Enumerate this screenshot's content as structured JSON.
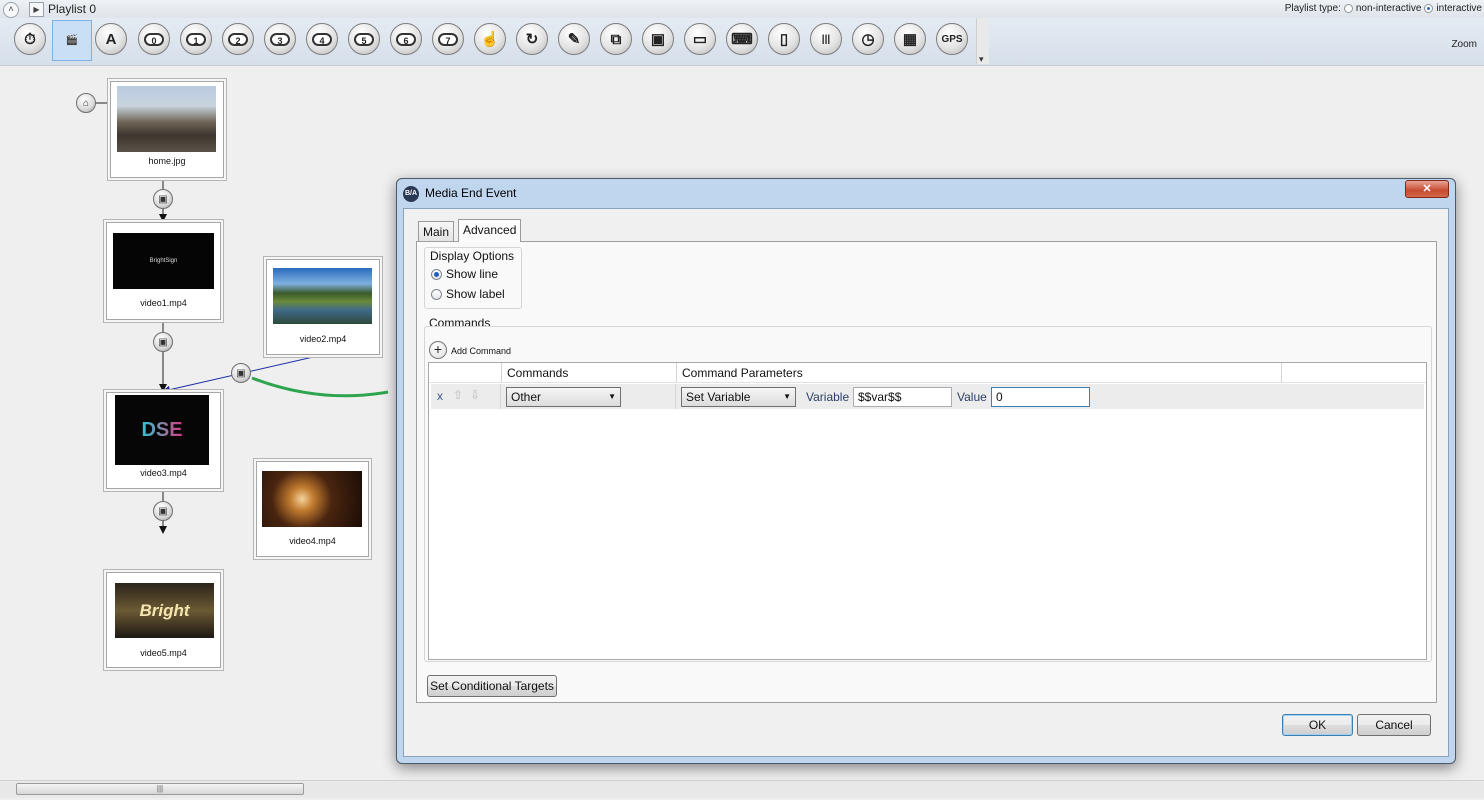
{
  "header": {
    "playlist_title": "Playlist 0",
    "playlist_type_label": "Playlist type:",
    "type_options": [
      {
        "label": "non-interactive",
        "selected": false
      },
      {
        "label": "interactive",
        "selected": true
      }
    ]
  },
  "toolbar": {
    "tools": [
      {
        "icon": "timer-icon",
        "glyph": "⏱"
      },
      {
        "icon": "clapperboard-icon",
        "glyph": "🎬",
        "selected": true
      },
      {
        "icon": "text-image-icon",
        "glyph": "A"
      },
      {
        "icon": "button-0-icon",
        "glyph": "0"
      },
      {
        "icon": "button-1-icon",
        "glyph": "1"
      },
      {
        "icon": "button-2-icon",
        "glyph": "2"
      },
      {
        "icon": "button-3-icon",
        "glyph": "3"
      },
      {
        "icon": "button-4-icon",
        "glyph": "4"
      },
      {
        "icon": "button-5-icon",
        "glyph": "5"
      },
      {
        "icon": "button-6-icon",
        "glyph": "6"
      },
      {
        "icon": "button-7-icon",
        "glyph": "7"
      },
      {
        "icon": "touch-icon",
        "glyph": "☝"
      },
      {
        "icon": "refresh-icon",
        "glyph": "↻"
      },
      {
        "icon": "serial-cable-icon",
        "glyph": "✎"
      },
      {
        "icon": "zone-icon",
        "glyph": "⧉"
      },
      {
        "icon": "media-end-icon",
        "glyph": "▣"
      },
      {
        "icon": "ir-remote-icon",
        "glyph": "▭"
      },
      {
        "icon": "keyboard-icon",
        "glyph": "⌨"
      },
      {
        "icon": "remote-control-icon",
        "glyph": "▯"
      },
      {
        "icon": "barcode-icon",
        "glyph": "|||"
      },
      {
        "icon": "timeclock-icon",
        "glyph": "◷"
      },
      {
        "icon": "calendar-icon",
        "glyph": "▦"
      },
      {
        "icon": "gps-icon",
        "glyph": "GPS"
      }
    ],
    "zoom_label": "Zoom"
  },
  "canvas": {
    "nodes": [
      {
        "caption": "home.jpg"
      },
      {
        "caption": "video1.mp4",
        "thumb_text": "BrightSign"
      },
      {
        "caption": "video2.mp4"
      },
      {
        "caption": "video3.mp4",
        "thumb_text": "DSE"
      },
      {
        "caption": "video4.mp4"
      },
      {
        "caption": "video5.mp4",
        "thumb_text": "Bright"
      }
    ]
  },
  "dialog": {
    "app_icon_text": "B/A",
    "title": "Media End Event",
    "close_glyph": "✕",
    "tabs": [
      {
        "label": "Main",
        "active": false
      },
      {
        "label": "Advanced",
        "active": true
      }
    ],
    "display_options": {
      "title": "Display Options",
      "options": [
        {
          "label": "Show line",
          "selected": true
        },
        {
          "label": "Show label",
          "selected": false
        }
      ]
    },
    "commands": {
      "group_title": "Commands",
      "add_label": "Add Command",
      "columns": [
        "",
        "Commands",
        "Command Parameters",
        ""
      ],
      "row": {
        "delete": "x",
        "command": "Other",
        "parameter": "Set Variable",
        "variable_label": "Variable",
        "variable_value": "$$var$$",
        "value_label": "Value",
        "value_value": "0"
      }
    },
    "set_conditional_targets": "Set Conditional Targets",
    "ok": "OK",
    "cancel": "Cancel"
  },
  "scrollbar": {
    "thumb_grip": "|||"
  }
}
